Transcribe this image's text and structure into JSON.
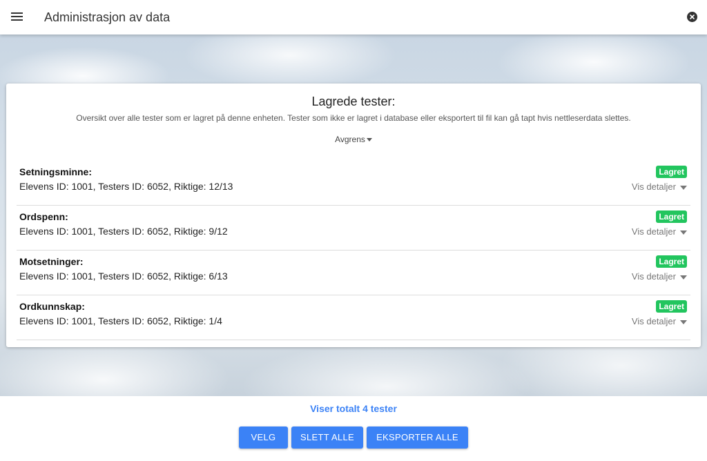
{
  "appbar": {
    "title": "Administrasjon av data",
    "menu_icon": "hamburger-menu-icon",
    "close_icon": "close-circle-icon"
  },
  "card": {
    "title": "Lagrede tester:",
    "description": "Oversikt over alle tester som er lagret på denne enheten. Tester som ikke er lagret i database eller eksportert til fil kan gå tapt hvis nettleserdata slettes.",
    "filter_label": "Avgrens"
  },
  "tests": [
    {
      "name": "Setningsminne:",
      "info": "Elevens ID: 1001, Testers ID: 6052, Riktige: 12/13",
      "status": "Lagret",
      "details_label": "Vis detaljer"
    },
    {
      "name": "Ordspenn:",
      "info": "Elevens ID: 1001, Testers ID: 6052, Riktige: 9/12",
      "status": "Lagret",
      "details_label": "Vis detaljer"
    },
    {
      "name": "Motsetninger:",
      "info": "Elevens ID: 1001, Testers ID: 6052, Riktige: 6/13",
      "status": "Lagret",
      "details_label": "Vis detaljer"
    },
    {
      "name": "Ordkunnskap:",
      "info": "Elevens ID: 1001, Testers ID: 6052, Riktige: 1/4",
      "status": "Lagret",
      "details_label": "Vis detaljer"
    }
  ],
  "footer": {
    "total_label": "Viser totalt 4 tester",
    "buttons": {
      "select": "VELG",
      "delete_all": "SLETT ALLE",
      "export_all": "EKSPORTER ALLE"
    }
  },
  "colors": {
    "accent": "#3b82f6",
    "status_saved": "#22c55e"
  }
}
